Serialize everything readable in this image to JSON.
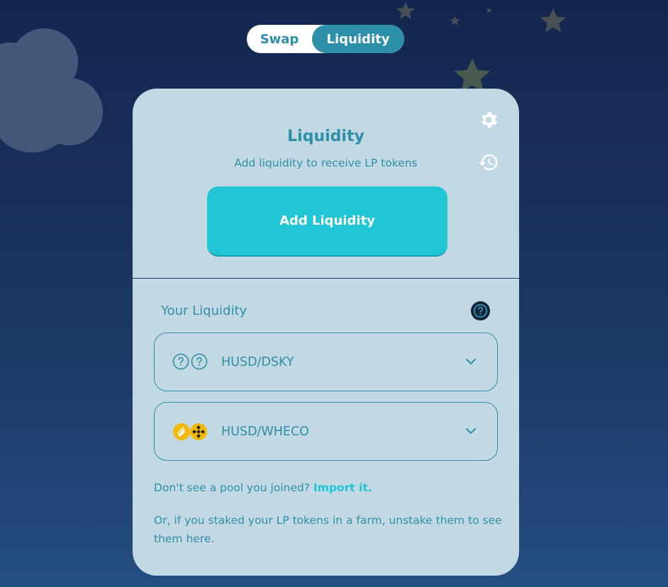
{
  "tabs": [
    {
      "label": "Swap",
      "active": false
    },
    {
      "label": "Liquidity",
      "active": true
    }
  ],
  "card": {
    "title": "Liquidity",
    "subtitle": "Add liquidity to receive LP tokens",
    "settings_icon": "gear-icon",
    "history_icon": "history-icon",
    "add_button": "Add Liquidity"
  },
  "your_liquidity": {
    "label": "Your Liquidity",
    "help_icon": "question-circle-icon",
    "pools": [
      {
        "name": "HUSD/DSKY",
        "icons": [
          "unknown-token-icon",
          "unknown-token-icon"
        ]
      },
      {
        "name": "HUSD/WHECO",
        "icons": [
          "husd-token-icon",
          "wheco-token-icon"
        ]
      }
    ]
  },
  "notes": {
    "import_prompt": "Don't see a pool you joined?",
    "import_link": "Import it.",
    "staked_hint": "Or, if you staked your LP tokens in a farm, unstake them to see them here."
  },
  "colors": {
    "accent": "#2e8fa8",
    "button": "#20c6d4",
    "card_bg": "#c2d8e2",
    "bg_top": "#13264f",
    "bg_bottom": "#244e82"
  }
}
